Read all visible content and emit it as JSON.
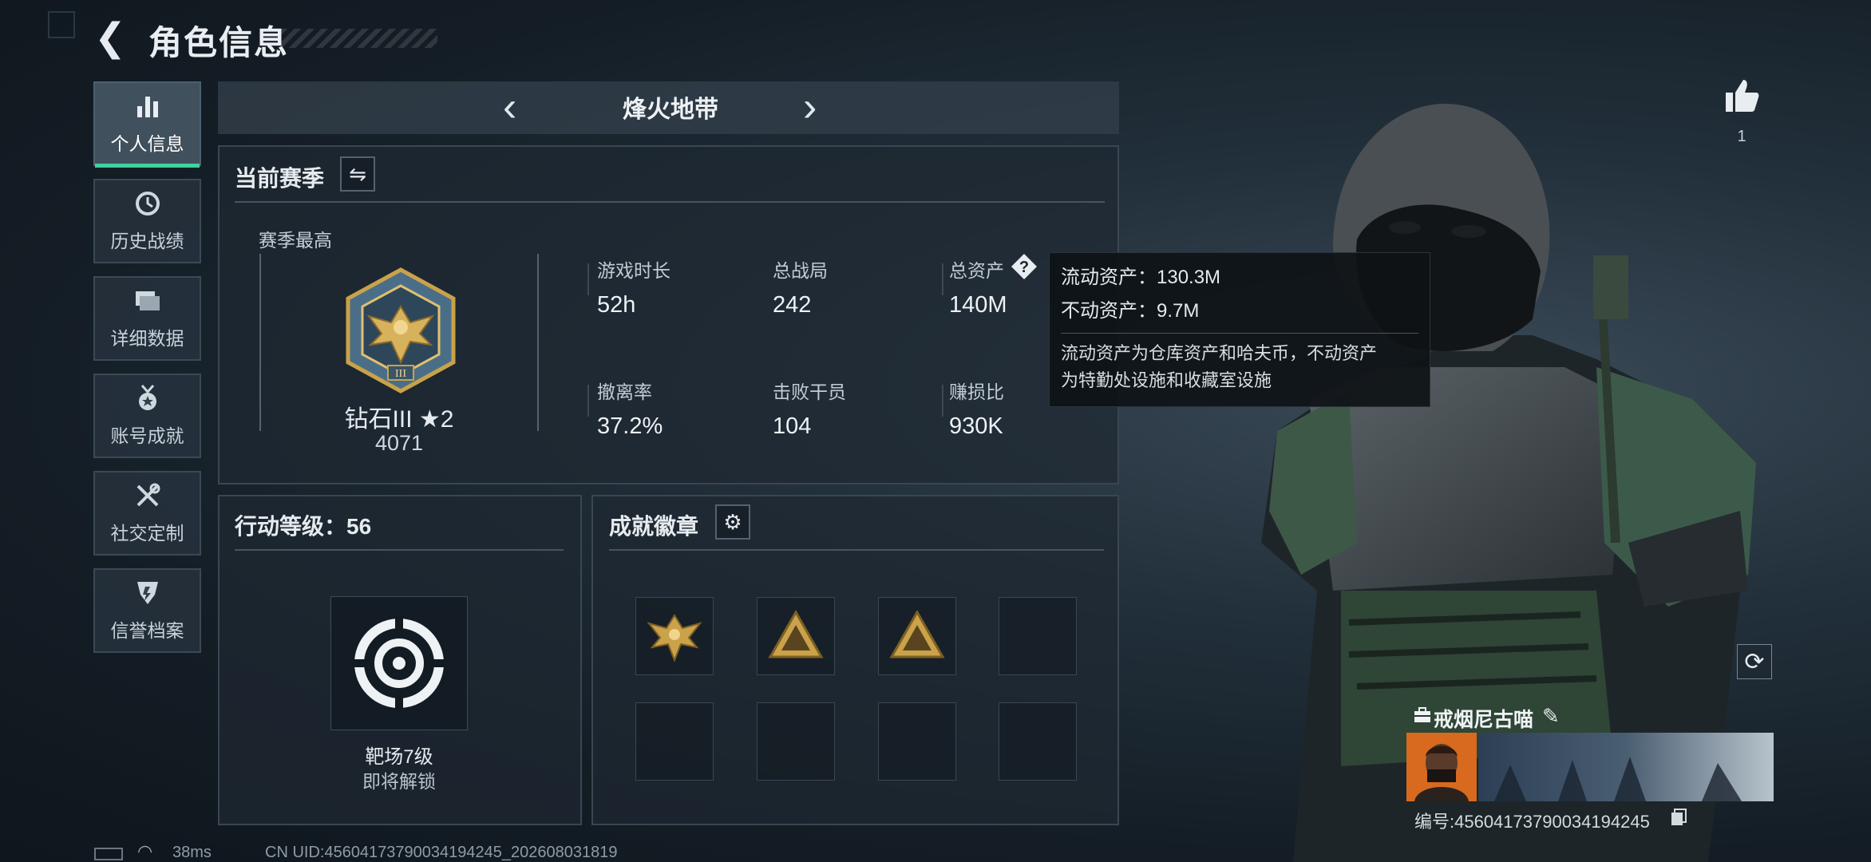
{
  "header": {
    "title": "角色信息"
  },
  "sidebar": {
    "items": [
      {
        "label": "个人信息",
        "icon": "bar-chart-icon",
        "active": true
      },
      {
        "label": "历史战绩",
        "icon": "clock-history-icon",
        "active": false
      },
      {
        "label": "详细数据",
        "icon": "folders-icon",
        "active": false
      },
      {
        "label": "账号成就",
        "icon": "medal-icon",
        "active": false
      },
      {
        "label": "社交定制",
        "icon": "tools-icon",
        "active": false
      },
      {
        "label": "信誉档案",
        "icon": "shield-icon",
        "active": false
      }
    ]
  },
  "mode": {
    "name": "烽火地带"
  },
  "season": {
    "title": "当前赛季",
    "best_label": "赛季最高",
    "rank_name": "钻石III ★2",
    "rank_score": "4071",
    "stats": [
      {
        "label": "游戏时长",
        "value": "52h"
      },
      {
        "label": "总战局",
        "value": "242"
      },
      {
        "label": "总资产",
        "value": "140M"
      },
      {
        "label": "撤离率",
        "value": "37.2%"
      },
      {
        "label": "击败干员",
        "value": "104"
      },
      {
        "label": "赚损比",
        "value": "930K"
      }
    ]
  },
  "tooltip": {
    "liquid": "流动资产：130.3M",
    "fixed": "不动资产：9.7M",
    "desc_line1": "流动资产为仓库资产和哈夫币，不动资产",
    "desc_line2": "为特勤处设施和收藏室设施"
  },
  "level": {
    "title": "行动等级：56",
    "range_name": "靶场7级",
    "range_status": "即将解锁"
  },
  "badges": {
    "title": "成就徽章",
    "slots": [
      "eagle-badge-icon",
      "triangle-badge-icon",
      "triangle-badge-icon",
      "",
      "",
      "",
      "",
      ""
    ]
  },
  "player": {
    "name": "戒烟尼古喵",
    "id": "编号:4560417379003419424​5",
    "likes": "1"
  },
  "status": {
    "ping": "38ms",
    "uid": "CN UID:4560417379003419424​5_202608031819"
  },
  "colors": {
    "accent": "#3fd3a0",
    "gold": "#c9a24a"
  }
}
